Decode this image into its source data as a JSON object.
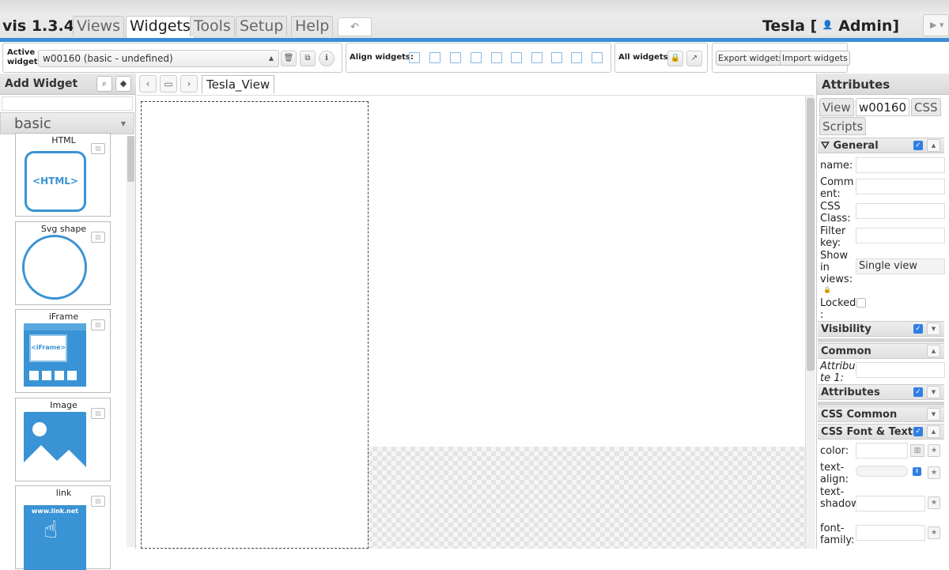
{
  "app": {
    "title": "vis 1.3.4",
    "user": "Tesla [",
    "role": "Admin]"
  },
  "menu_tabs": [
    "Views",
    "Widgets",
    "Tools",
    "Setup",
    "Help"
  ],
  "toolbar": {
    "active_widget_label": "Active widget:",
    "active_widget_value": "w00160 (basic - undefined)",
    "align_label": "Align widgets:",
    "all_widgets_label": "All widgets:",
    "export_label": "Export widgets",
    "import_label": "Import widgets"
  },
  "left": {
    "title": "Add Widget",
    "set": "basic",
    "widgets": [
      "HTML",
      "Svg shape",
      "iFrame",
      "Image",
      "link"
    ],
    "html_icon_text": "<HTML>",
    "iframe_icon_text": "<iFrame>",
    "link_icon_text": "www.link.net"
  },
  "view_tab": "Tesla_View",
  "right": {
    "title": "Attributes",
    "tabs": [
      "View",
      "w00160",
      "CSS",
      "Scripts"
    ],
    "sections": {
      "general": "General",
      "visibility": "Visibility",
      "common": "Common",
      "attributes": "Attributes",
      "css_common": "CSS Common",
      "css_font": "CSS Font & Text"
    },
    "fields": {
      "name": "name:",
      "comment": "Comm ent:",
      "css_class": "CSS Class:",
      "filter_key": "Filter key:",
      "show_in_views": "Show in views:",
      "show_in_views_value": "Single view",
      "locked": "Locked :",
      "attribute1": "Attribu te 1:",
      "color": "color:",
      "text_align": "text-align:",
      "text_shadow": "text-shadow:",
      "font_family": "font-family:"
    }
  },
  "colors": {
    "accent": "#3a8ed6",
    "checkbox": "#2f7ee3",
    "icon_blue": "#3a93d4"
  }
}
